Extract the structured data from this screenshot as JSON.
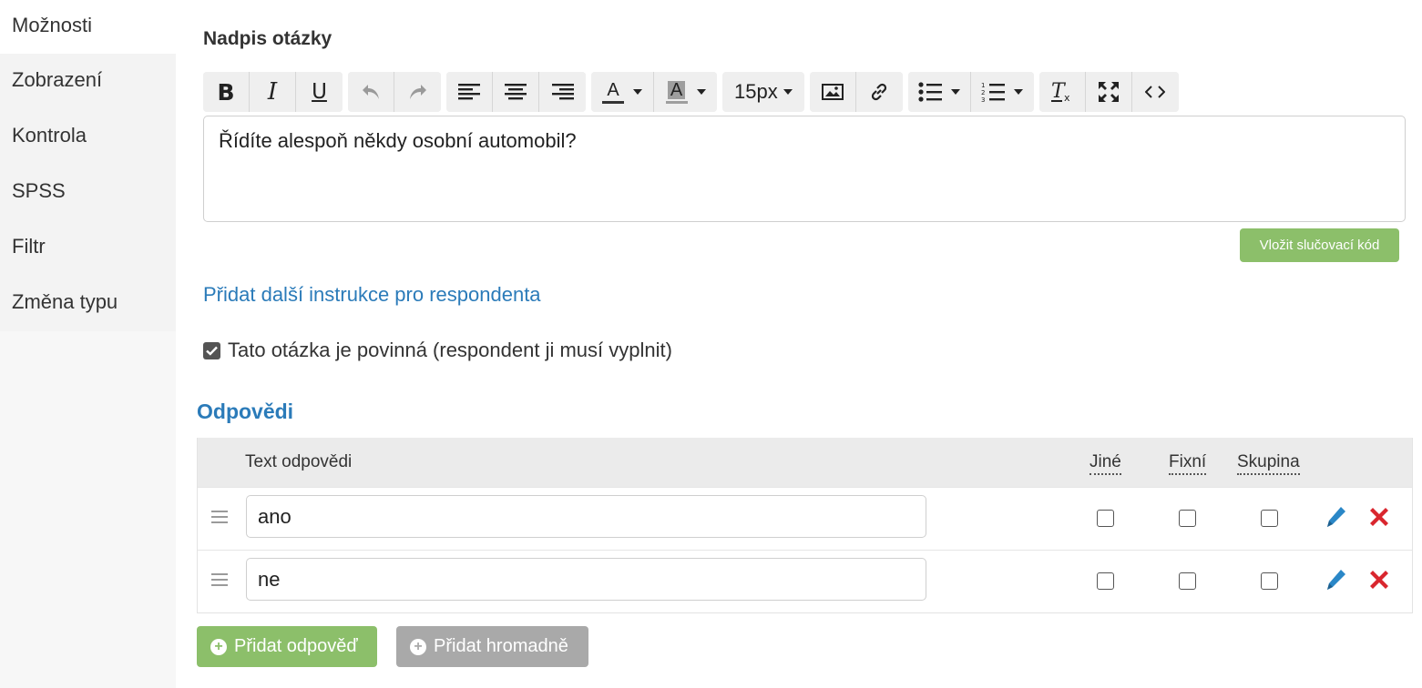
{
  "sidebar": {
    "items": [
      {
        "label": "Možnosti"
      },
      {
        "label": "Zobrazení"
      },
      {
        "label": "Kontrola"
      },
      {
        "label": "SPSS"
      },
      {
        "label": "Filtr"
      },
      {
        "label": "Změna typu"
      }
    ]
  },
  "question": {
    "title_label": "Nadpis otázky",
    "text": "Řídíte alespoň někdy osobní automobil?"
  },
  "toolbar": {
    "bold": "B",
    "italic": "I",
    "underline": "U",
    "font_color_letter": "A",
    "bg_color_letter": "A",
    "font_size": "15px",
    "font_color": "#333333",
    "bg_color": "#9e9e9e"
  },
  "merge_button": "Vložit slučovací kód",
  "instructions_link": "Přidat další instrukce pro respondenta",
  "required": {
    "checked": true,
    "label": "Tato otázka je povinná (respondent ji musí vyplnit)"
  },
  "answers": {
    "heading": "Odpovědi",
    "columns": {
      "text": "Text odpovědi",
      "other": "Jiné",
      "fixed": "Fixní",
      "group": "Skupina"
    },
    "rows": [
      {
        "text": "ano",
        "other": false,
        "fixed": false,
        "group": false
      },
      {
        "text": "ne",
        "other": false,
        "fixed": false,
        "group": false
      }
    ],
    "add_one": "Přidat odpověď",
    "add_bulk": "Přidat hromadně"
  },
  "colors": {
    "accent_blue": "#2b7bb9",
    "green": "#8cbf6a",
    "gray_button": "#a9a9a9",
    "delete_red": "#d9262e",
    "edit_blue": "#2a87c7"
  }
}
